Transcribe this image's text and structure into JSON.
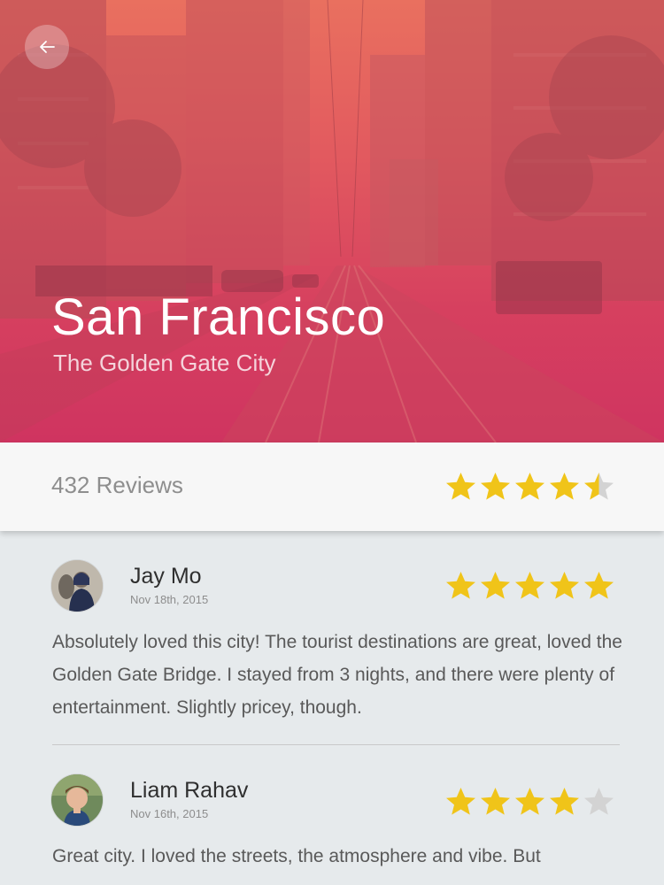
{
  "hero": {
    "title": "San Francisco",
    "subtitle": "The Golden Gate City",
    "back_icon": "arrow-left-icon",
    "gradient_top": "#e9705f",
    "gradient_bottom": "#cf3460"
  },
  "summary": {
    "review_count": "432 Reviews",
    "rating": 4.5
  },
  "colors": {
    "star_filled": "#f0c419",
    "star_empty": "#d3d3d3"
  },
  "reviews": [
    {
      "author": "Jay Mo",
      "date": "Nov 18th, 2015",
      "rating": 5,
      "text": "Absolutely loved this city! The tourist destinations are great, loved the Golden Gate Bridge. I stayed from 3 nights, and there were plenty of entertainment. Slightly pricey, though."
    },
    {
      "author": "Liam Rahav",
      "date": "Nov 16th, 2015",
      "rating": 4,
      "text": "Great city. I loved the streets, the atmosphere and vibe. But"
    }
  ]
}
